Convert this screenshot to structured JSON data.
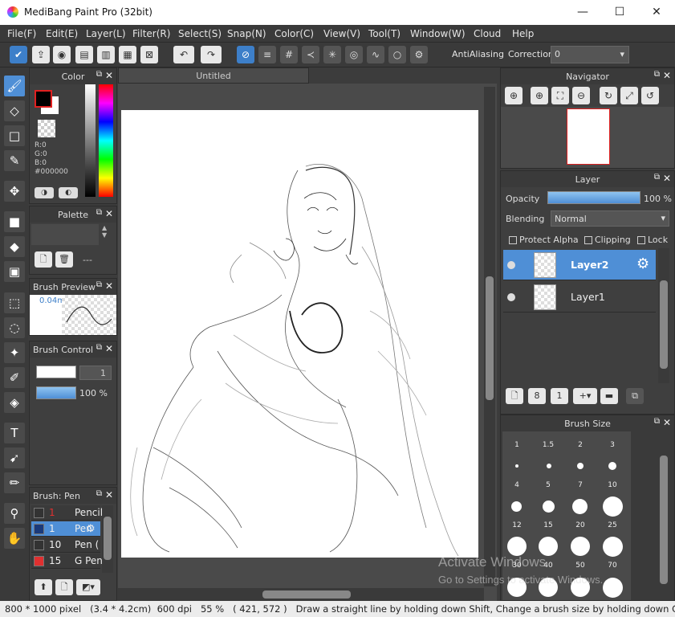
{
  "window": {
    "title": "MediBang Paint Pro (32bit)",
    "minimize": "—",
    "maximize": "☐",
    "close": "✕"
  },
  "menu": [
    "File(F)",
    "Edit(E)",
    "Layer(L)",
    "Filter(R)",
    "Select(S)",
    "Snap(N)",
    "Color(C)",
    "View(V)",
    "Tool(T)",
    "Window(W)",
    "Cloud",
    "Help"
  ],
  "toolbar": {
    "antialias_label": "AntiAliasing",
    "correction_label": "Correction",
    "correction_value": "0"
  },
  "document": {
    "tab": "Untitled"
  },
  "panels": {
    "color": {
      "title": "Color",
      "r": "R:0",
      "g": "G:0",
      "b": "B:0",
      "hex": "#000000",
      "fg": "#000000",
      "bg": "#ffffff"
    },
    "palette": {
      "title": "Palette",
      "dash": "---"
    },
    "brush_preview": {
      "title": "Brush Preview",
      "size": "0.04m"
    },
    "brush_control": {
      "title": "Brush Control",
      "size_value": "1",
      "opacity_value": "100 %"
    },
    "brush_list": {
      "title": "Brush: Pen",
      "items": [
        {
          "num": "1",
          "name": "Pencil",
          "color": "#333333"
        },
        {
          "num": "1",
          "name": "Pen",
          "color": "#1a3a7a",
          "selected": true
        },
        {
          "num": "10",
          "name": "Pen (",
          "color": "#333333"
        },
        {
          "num": "15",
          "name": "G Pen",
          "color": "#e03030"
        }
      ]
    },
    "navigator": {
      "title": "Navigator"
    },
    "layer": {
      "title": "Layer",
      "opacity_label": "Opacity",
      "opacity_value": "100 %",
      "blending_label": "Blending",
      "blending_value": "Normal",
      "protect_alpha": "Protect Alpha",
      "clipping": "Clipping",
      "lock": "Lock",
      "layers": [
        {
          "name": "Layer2",
          "selected": true
        },
        {
          "name": "Layer1",
          "selected": false
        }
      ]
    },
    "brush_size": {
      "title": "Brush Size",
      "sizes": [
        "1",
        "1.5",
        "2",
        "3",
        "4",
        "5",
        "7",
        "10",
        "12",
        "15",
        "20",
        "25",
        "30",
        "40",
        "50",
        "70"
      ]
    }
  },
  "status": {
    "dims": "800 * 1000 pixel",
    "size_cm": "(3.4 * 4.2cm)",
    "dpi": "600 dpi",
    "zoom": "55 %",
    "coords": "( 421, 572 )",
    "hint": "Draw a straight line by holding down Shift, Change a brush size by holding down Ctrl, Alt, and dr"
  },
  "watermark": {
    "line1": "Activate Windows",
    "line2": "Go to Settings to activate Windows."
  }
}
